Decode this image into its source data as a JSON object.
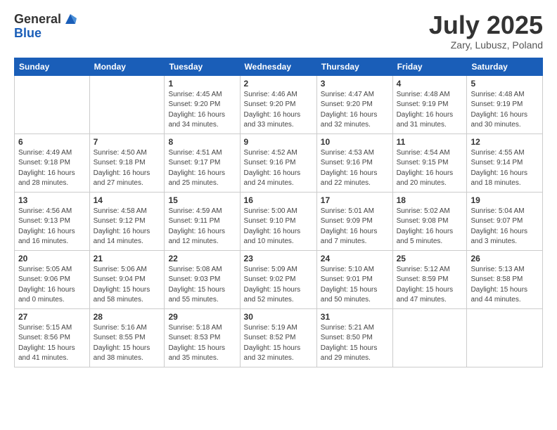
{
  "header": {
    "logo_general": "General",
    "logo_blue": "Blue",
    "month_title": "July 2025",
    "location": "Zary, Lubusz, Poland"
  },
  "weekdays": [
    "Sunday",
    "Monday",
    "Tuesday",
    "Wednesday",
    "Thursday",
    "Friday",
    "Saturday"
  ],
  "weeks": [
    [
      {
        "day": "",
        "info": ""
      },
      {
        "day": "",
        "info": ""
      },
      {
        "day": "1",
        "info": "Sunrise: 4:45 AM\nSunset: 9:20 PM\nDaylight: 16 hours\nand 34 minutes."
      },
      {
        "day": "2",
        "info": "Sunrise: 4:46 AM\nSunset: 9:20 PM\nDaylight: 16 hours\nand 33 minutes."
      },
      {
        "day": "3",
        "info": "Sunrise: 4:47 AM\nSunset: 9:20 PM\nDaylight: 16 hours\nand 32 minutes."
      },
      {
        "day": "4",
        "info": "Sunrise: 4:48 AM\nSunset: 9:19 PM\nDaylight: 16 hours\nand 31 minutes."
      },
      {
        "day": "5",
        "info": "Sunrise: 4:48 AM\nSunset: 9:19 PM\nDaylight: 16 hours\nand 30 minutes."
      }
    ],
    [
      {
        "day": "6",
        "info": "Sunrise: 4:49 AM\nSunset: 9:18 PM\nDaylight: 16 hours\nand 28 minutes."
      },
      {
        "day": "7",
        "info": "Sunrise: 4:50 AM\nSunset: 9:18 PM\nDaylight: 16 hours\nand 27 minutes."
      },
      {
        "day": "8",
        "info": "Sunrise: 4:51 AM\nSunset: 9:17 PM\nDaylight: 16 hours\nand 25 minutes."
      },
      {
        "day": "9",
        "info": "Sunrise: 4:52 AM\nSunset: 9:16 PM\nDaylight: 16 hours\nand 24 minutes."
      },
      {
        "day": "10",
        "info": "Sunrise: 4:53 AM\nSunset: 9:16 PM\nDaylight: 16 hours\nand 22 minutes."
      },
      {
        "day": "11",
        "info": "Sunrise: 4:54 AM\nSunset: 9:15 PM\nDaylight: 16 hours\nand 20 minutes."
      },
      {
        "day": "12",
        "info": "Sunrise: 4:55 AM\nSunset: 9:14 PM\nDaylight: 16 hours\nand 18 minutes."
      }
    ],
    [
      {
        "day": "13",
        "info": "Sunrise: 4:56 AM\nSunset: 9:13 PM\nDaylight: 16 hours\nand 16 minutes."
      },
      {
        "day": "14",
        "info": "Sunrise: 4:58 AM\nSunset: 9:12 PM\nDaylight: 16 hours\nand 14 minutes."
      },
      {
        "day": "15",
        "info": "Sunrise: 4:59 AM\nSunset: 9:11 PM\nDaylight: 16 hours\nand 12 minutes."
      },
      {
        "day": "16",
        "info": "Sunrise: 5:00 AM\nSunset: 9:10 PM\nDaylight: 16 hours\nand 10 minutes."
      },
      {
        "day": "17",
        "info": "Sunrise: 5:01 AM\nSunset: 9:09 PM\nDaylight: 16 hours\nand 7 minutes."
      },
      {
        "day": "18",
        "info": "Sunrise: 5:02 AM\nSunset: 9:08 PM\nDaylight: 16 hours\nand 5 minutes."
      },
      {
        "day": "19",
        "info": "Sunrise: 5:04 AM\nSunset: 9:07 PM\nDaylight: 16 hours\nand 3 minutes."
      }
    ],
    [
      {
        "day": "20",
        "info": "Sunrise: 5:05 AM\nSunset: 9:06 PM\nDaylight: 16 hours\nand 0 minutes."
      },
      {
        "day": "21",
        "info": "Sunrise: 5:06 AM\nSunset: 9:04 PM\nDaylight: 15 hours\nand 58 minutes."
      },
      {
        "day": "22",
        "info": "Sunrise: 5:08 AM\nSunset: 9:03 PM\nDaylight: 15 hours\nand 55 minutes."
      },
      {
        "day": "23",
        "info": "Sunrise: 5:09 AM\nSunset: 9:02 PM\nDaylight: 15 hours\nand 52 minutes."
      },
      {
        "day": "24",
        "info": "Sunrise: 5:10 AM\nSunset: 9:01 PM\nDaylight: 15 hours\nand 50 minutes."
      },
      {
        "day": "25",
        "info": "Sunrise: 5:12 AM\nSunset: 8:59 PM\nDaylight: 15 hours\nand 47 minutes."
      },
      {
        "day": "26",
        "info": "Sunrise: 5:13 AM\nSunset: 8:58 PM\nDaylight: 15 hours\nand 44 minutes."
      }
    ],
    [
      {
        "day": "27",
        "info": "Sunrise: 5:15 AM\nSunset: 8:56 PM\nDaylight: 15 hours\nand 41 minutes."
      },
      {
        "day": "28",
        "info": "Sunrise: 5:16 AM\nSunset: 8:55 PM\nDaylight: 15 hours\nand 38 minutes."
      },
      {
        "day": "29",
        "info": "Sunrise: 5:18 AM\nSunset: 8:53 PM\nDaylight: 15 hours\nand 35 minutes."
      },
      {
        "day": "30",
        "info": "Sunrise: 5:19 AM\nSunset: 8:52 PM\nDaylight: 15 hours\nand 32 minutes."
      },
      {
        "day": "31",
        "info": "Sunrise: 5:21 AM\nSunset: 8:50 PM\nDaylight: 15 hours\nand 29 minutes."
      },
      {
        "day": "",
        "info": ""
      },
      {
        "day": "",
        "info": ""
      }
    ]
  ]
}
